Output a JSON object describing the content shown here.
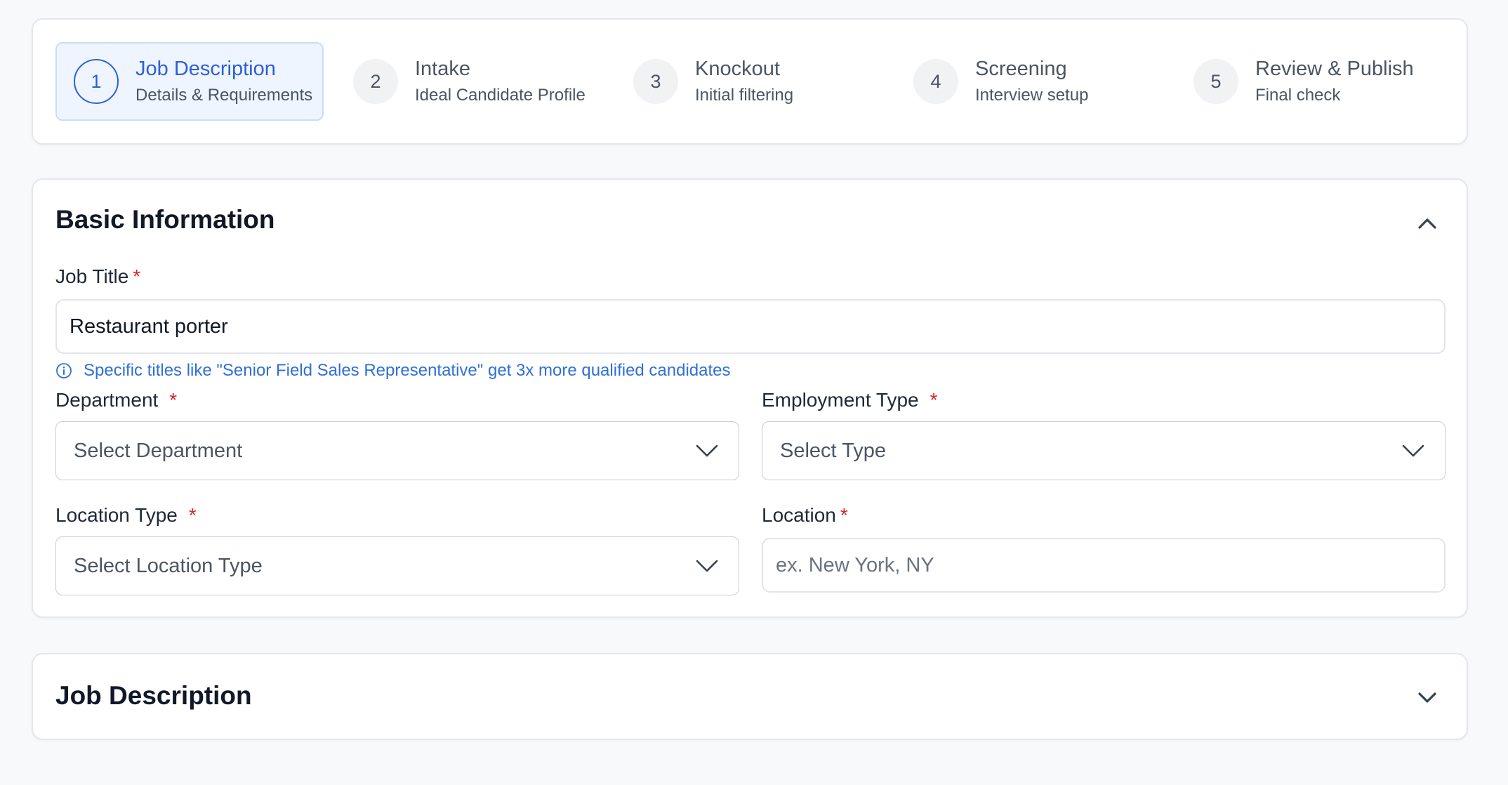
{
  "stepper": {
    "steps": [
      {
        "number": "1",
        "title": "Job Description",
        "subtitle": "Details & Requirements",
        "active": true
      },
      {
        "number": "2",
        "title": "Intake",
        "subtitle": "Ideal Candidate Profile",
        "active": false
      },
      {
        "number": "3",
        "title": "Knockout",
        "subtitle": "Initial filtering",
        "active": false
      },
      {
        "number": "4",
        "title": "Screening",
        "subtitle": "Interview setup",
        "active": false
      },
      {
        "number": "5",
        "title": "Review & Publish",
        "subtitle": "Final check",
        "active": false
      }
    ]
  },
  "basic_info": {
    "title": "Basic Information",
    "collapse_icon": "chevron-up-icon",
    "job_title": {
      "label": "Job Title",
      "required_mark": "*",
      "value": "Restaurant porter",
      "hint": "Specific titles like \"Senior Field Sales Representative\" get 3x more qualified candidates",
      "hint_icon": "info-icon"
    },
    "department": {
      "label": "Department",
      "required_mark": "*",
      "placeholder": "Select Department"
    },
    "employment_type": {
      "label": "Employment Type",
      "required_mark": "*",
      "placeholder": "Select Type"
    },
    "location_type": {
      "label": "Location Type",
      "required_mark": "*",
      "placeholder": "Select Location Type"
    },
    "location": {
      "label": "Location",
      "required_mark": "*",
      "placeholder": "ex. New York, NY"
    }
  },
  "job_description_section": {
    "title": "Job Description",
    "expand_icon": "chevron-down-icon"
  },
  "colors": {
    "accent": "#2f5fd6",
    "hint": "#2f6fd8",
    "required": "#dc2626",
    "active_step_bg": "#eef5ff"
  }
}
